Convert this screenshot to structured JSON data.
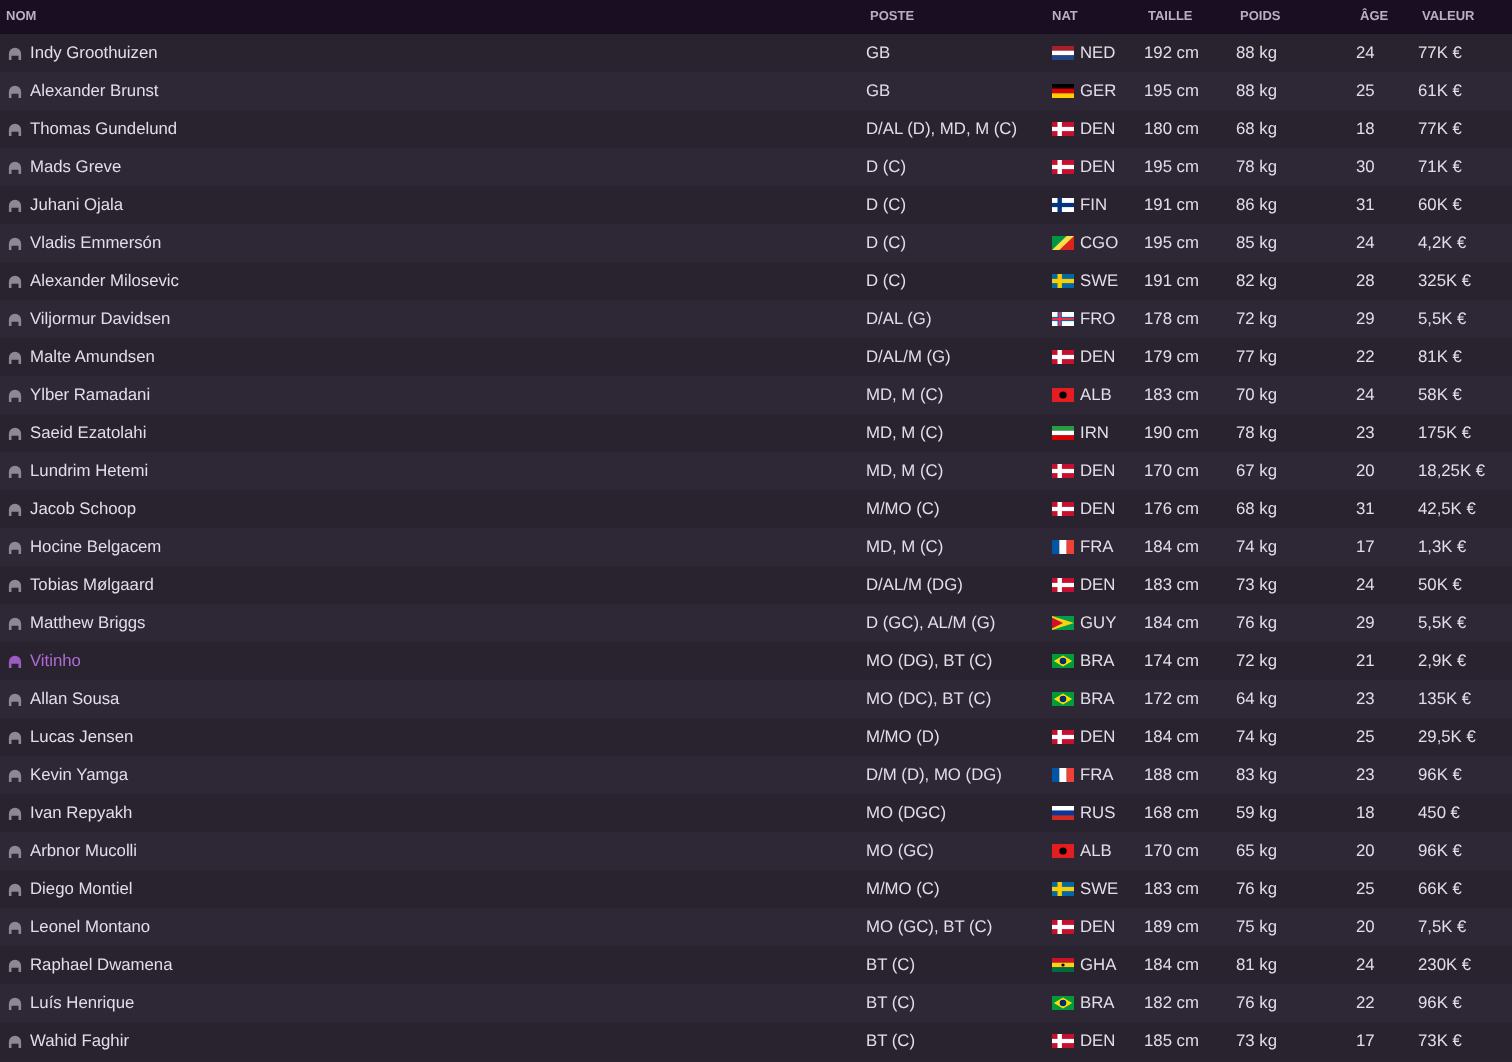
{
  "columns": [
    "NOM",
    "POSTE",
    "NAT",
    "TAILLE",
    "POIDS",
    "ÂGE",
    "VALEUR"
  ],
  "rows": [
    {
      "name": "Indy Groothuizen",
      "position": "GB",
      "flag": {
        "kind": "nl"
      },
      "nat": "NED",
      "height": "192 cm",
      "weight": "88 kg",
      "age": "24",
      "value": "77K €",
      "highlighted": false
    },
    {
      "name": "Alexander Brunst",
      "position": "GB",
      "flag": {
        "kind": "de"
      },
      "nat": "GER",
      "height": "195 cm",
      "weight": "88 kg",
      "age": "25",
      "value": "61K €",
      "highlighted": false
    },
    {
      "name": "Thomas Gundelund",
      "position": "D/AL (D), MD, M (C)",
      "flag": {
        "kind": "dk"
      },
      "nat": "DEN",
      "height": "180 cm",
      "weight": "68 kg",
      "age": "18",
      "value": "77K €",
      "highlighted": false
    },
    {
      "name": "Mads Greve",
      "position": "D (C)",
      "flag": {
        "kind": "dk"
      },
      "nat": "DEN",
      "height": "195 cm",
      "weight": "78 kg",
      "age": "30",
      "value": "71K €",
      "highlighted": false
    },
    {
      "name": "Juhani Ojala",
      "position": "D (C)",
      "flag": {
        "kind": "fi"
      },
      "nat": "FIN",
      "height": "191 cm",
      "weight": "86 kg",
      "age": "31",
      "value": "60K €",
      "highlighted": false
    },
    {
      "name": "Vladis Emmersón",
      "position": "D (C)",
      "flag": {
        "kind": "cg"
      },
      "nat": "CGO",
      "height": "195 cm",
      "weight": "85 kg",
      "age": "24",
      "value": "4,2K €",
      "highlighted": false
    },
    {
      "name": "Alexander Milosevic",
      "position": "D (C)",
      "flag": {
        "kind": "se"
      },
      "nat": "SWE",
      "height": "191 cm",
      "weight": "82 kg",
      "age": "28",
      "value": "325K €",
      "highlighted": false
    },
    {
      "name": "Viljormur Davidsen",
      "position": "D/AL (G)",
      "flag": {
        "kind": "fo"
      },
      "nat": "FRO",
      "height": "178 cm",
      "weight": "72 kg",
      "age": "29",
      "value": "5,5K €",
      "highlighted": false
    },
    {
      "name": "Malte Amundsen",
      "position": "D/AL/M (G)",
      "flag": {
        "kind": "dk"
      },
      "nat": "DEN",
      "height": "179 cm",
      "weight": "77 kg",
      "age": "22",
      "value": "81K €",
      "highlighted": false
    },
    {
      "name": "Ylber Ramadani",
      "position": "MD, M (C)",
      "flag": {
        "kind": "al"
      },
      "nat": "ALB",
      "height": "183 cm",
      "weight": "70 kg",
      "age": "24",
      "value": "58K €",
      "highlighted": false
    },
    {
      "name": "Saeid Ezatolahi",
      "position": "MD, M (C)",
      "flag": {
        "kind": "ir"
      },
      "nat": "IRN",
      "height": "190 cm",
      "weight": "78 kg",
      "age": "23",
      "value": "175K €",
      "highlighted": false
    },
    {
      "name": "Lundrim Hetemi",
      "position": "MD, M (C)",
      "flag": {
        "kind": "dk"
      },
      "nat": "DEN",
      "height": "170 cm",
      "weight": "67 kg",
      "age": "20",
      "value": "18,25K €",
      "highlighted": false
    },
    {
      "name": "Jacob Schoop",
      "position": "M/MO (C)",
      "flag": {
        "kind": "dk"
      },
      "nat": "DEN",
      "height": "176 cm",
      "weight": "68 kg",
      "age": "31",
      "value": "42,5K €",
      "highlighted": false
    },
    {
      "name": "Hocine Belgacem",
      "position": "MD, M (C)",
      "flag": {
        "kind": "fr"
      },
      "nat": "FRA",
      "height": "184 cm",
      "weight": "74 kg",
      "age": "17",
      "value": "1,3K €",
      "highlighted": false
    },
    {
      "name": "Tobias Mølgaard",
      "position": "D/AL/M (DG)",
      "flag": {
        "kind": "dk"
      },
      "nat": "DEN",
      "height": "183 cm",
      "weight": "73 kg",
      "age": "24",
      "value": "50K €",
      "highlighted": false
    },
    {
      "name": "Matthew Briggs",
      "position": "D (GC), AL/M (G)",
      "flag": {
        "kind": "gy"
      },
      "nat": "GUY",
      "height": "184 cm",
      "weight": "76 kg",
      "age": "29",
      "value": "5,5K €",
      "highlighted": false
    },
    {
      "name": "Vitinho",
      "position": "MO (DG), BT (C)",
      "flag": {
        "kind": "br"
      },
      "nat": "BRA",
      "height": "174 cm",
      "weight": "72 kg",
      "age": "21",
      "value": "2,9K €",
      "highlighted": true
    },
    {
      "name": "Allan Sousa",
      "position": "MO (DC), BT (C)",
      "flag": {
        "kind": "br"
      },
      "nat": "BRA",
      "height": "172 cm",
      "weight": "64 kg",
      "age": "23",
      "value": "135K €",
      "highlighted": false
    },
    {
      "name": "Lucas Jensen",
      "position": "M/MO (D)",
      "flag": {
        "kind": "dk"
      },
      "nat": "DEN",
      "height": "184 cm",
      "weight": "74 kg",
      "age": "25",
      "value": "29,5K €",
      "highlighted": false
    },
    {
      "name": "Kevin Yamga",
      "position": "D/M (D), MO (DG)",
      "flag": {
        "kind": "fr"
      },
      "nat": "FRA",
      "height": "188 cm",
      "weight": "83 kg",
      "age": "23",
      "value": "96K €",
      "highlighted": false
    },
    {
      "name": "Ivan Repyakh",
      "position": "MO (DGC)",
      "flag": {
        "kind": "ru"
      },
      "nat": "RUS",
      "height": "168 cm",
      "weight": "59 kg",
      "age": "18",
      "value": "450 €",
      "highlighted": false
    },
    {
      "name": "Arbnor Mucolli",
      "position": "MO (GC)",
      "flag": {
        "kind": "al"
      },
      "nat": "ALB",
      "height": "170 cm",
      "weight": "65 kg",
      "age": "20",
      "value": "96K €",
      "highlighted": false
    },
    {
      "name": "Diego Montiel",
      "position": "M/MO (C)",
      "flag": {
        "kind": "se"
      },
      "nat": "SWE",
      "height": "183 cm",
      "weight": "76 kg",
      "age": "25",
      "value": "66K €",
      "highlighted": false
    },
    {
      "name": "Leonel Montano",
      "position": "MO (GC), BT (C)",
      "flag": {
        "kind": "dk"
      },
      "nat": "DEN",
      "height": "189 cm",
      "weight": "75 kg",
      "age": "20",
      "value": "7,5K €",
      "highlighted": false
    },
    {
      "name": "Raphael Dwamena",
      "position": "BT (C)",
      "flag": {
        "kind": "gh"
      },
      "nat": "GHA",
      "height": "184 cm",
      "weight": "81 kg",
      "age": "24",
      "value": "230K €",
      "highlighted": false
    },
    {
      "name": "Luís Henrique",
      "position": "BT (C)",
      "flag": {
        "kind": "br"
      },
      "nat": "BRA",
      "height": "182 cm",
      "weight": "76 kg",
      "age": "22",
      "value": "96K €",
      "highlighted": false
    },
    {
      "name": "Wahid Faghir",
      "position": "BT (C)",
      "flag": {
        "kind": "dk"
      },
      "nat": "DEN",
      "height": "185 cm",
      "weight": "73 kg",
      "age": "17",
      "value": "73K €",
      "highlighted": false
    }
  ]
}
